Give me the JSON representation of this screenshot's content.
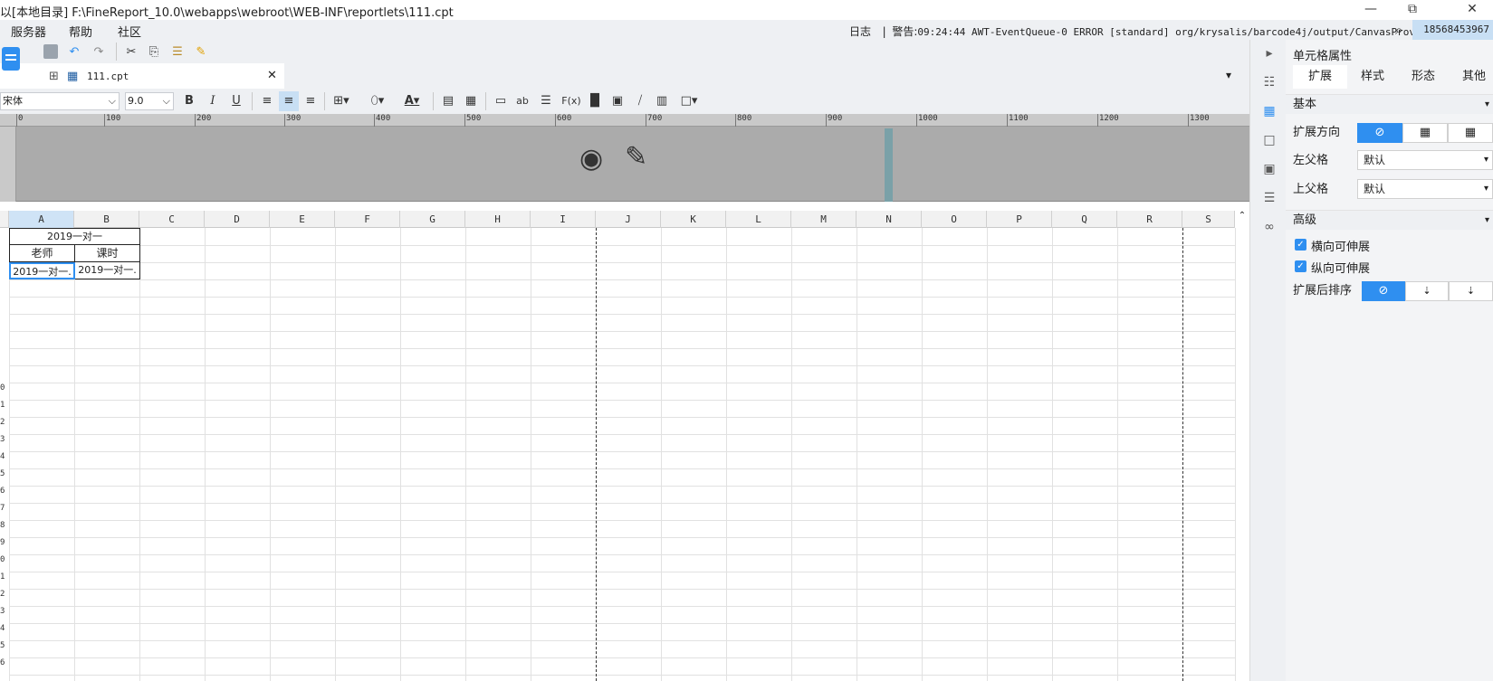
{
  "window": {
    "title": "以[本地目录]   F:\\FineReport_10.0\\webapps\\webroot\\WEB-INF\\reportlets\\111.cpt",
    "minimize": "—",
    "restore": "⧉",
    "close": "✕"
  },
  "menu": {
    "items": [
      "服务器",
      "帮助",
      "社区"
    ],
    "log_label": "日志",
    "warn_label": "警告:",
    "log_message": "09:24:44 AWT-EventQueue-0 ERROR [standard] org/krysalis/barcode4j/output/CanvasProvider",
    "user": "18568453967"
  },
  "tab": {
    "label": "111.cpt"
  },
  "format": {
    "font_name": "宋体",
    "font_size": "9.0",
    "bold": "B",
    "italic": "I",
    "underline": "U",
    "ab": "ab",
    "fx": "F(x)"
  },
  "ruler": {
    "labels": [
      "0",
      "100",
      "200",
      "300",
      "400",
      "500",
      "600",
      "700",
      "800",
      "900",
      "1000",
      "1100",
      "1200",
      "1300"
    ]
  },
  "grid": {
    "columns": [
      "A",
      "B",
      "C",
      "D",
      "E",
      "F",
      "G",
      "H",
      "I",
      "J",
      "K",
      "L",
      "M",
      "N",
      "O",
      "P",
      "Q",
      "R",
      "S"
    ],
    "rows": [
      "",
      "",
      "",
      "",
      "",
      "",
      "",
      "",
      "",
      "0",
      "1",
      "2",
      "3",
      "4",
      "5",
      "6",
      "7",
      "8",
      "9",
      "0",
      "1",
      "2",
      "3",
      "4",
      "5",
      "6"
    ],
    "cells": {
      "a1_merged": "2019一对一",
      "a2": "老师",
      "b2": "课时",
      "a3": "2019一对一.",
      "b3": "2019一对一."
    }
  },
  "props": {
    "title": "单元格属性",
    "tabs": [
      "扩展",
      "样式",
      "形态",
      "其他"
    ],
    "section_basic": "基本",
    "expand_dir_label": "扩展方向",
    "left_parent_label": "左父格",
    "left_parent_value": "默认",
    "top_parent_label": "上父格",
    "top_parent_value": "默认",
    "section_adv": "高级",
    "h_expand": "横向可伸展",
    "v_expand": "纵向可伸展",
    "sort_label": "扩展后排序"
  },
  "colors": {
    "accent": "#2f8ff0",
    "selected_tab_bg": "#ffffff"
  }
}
